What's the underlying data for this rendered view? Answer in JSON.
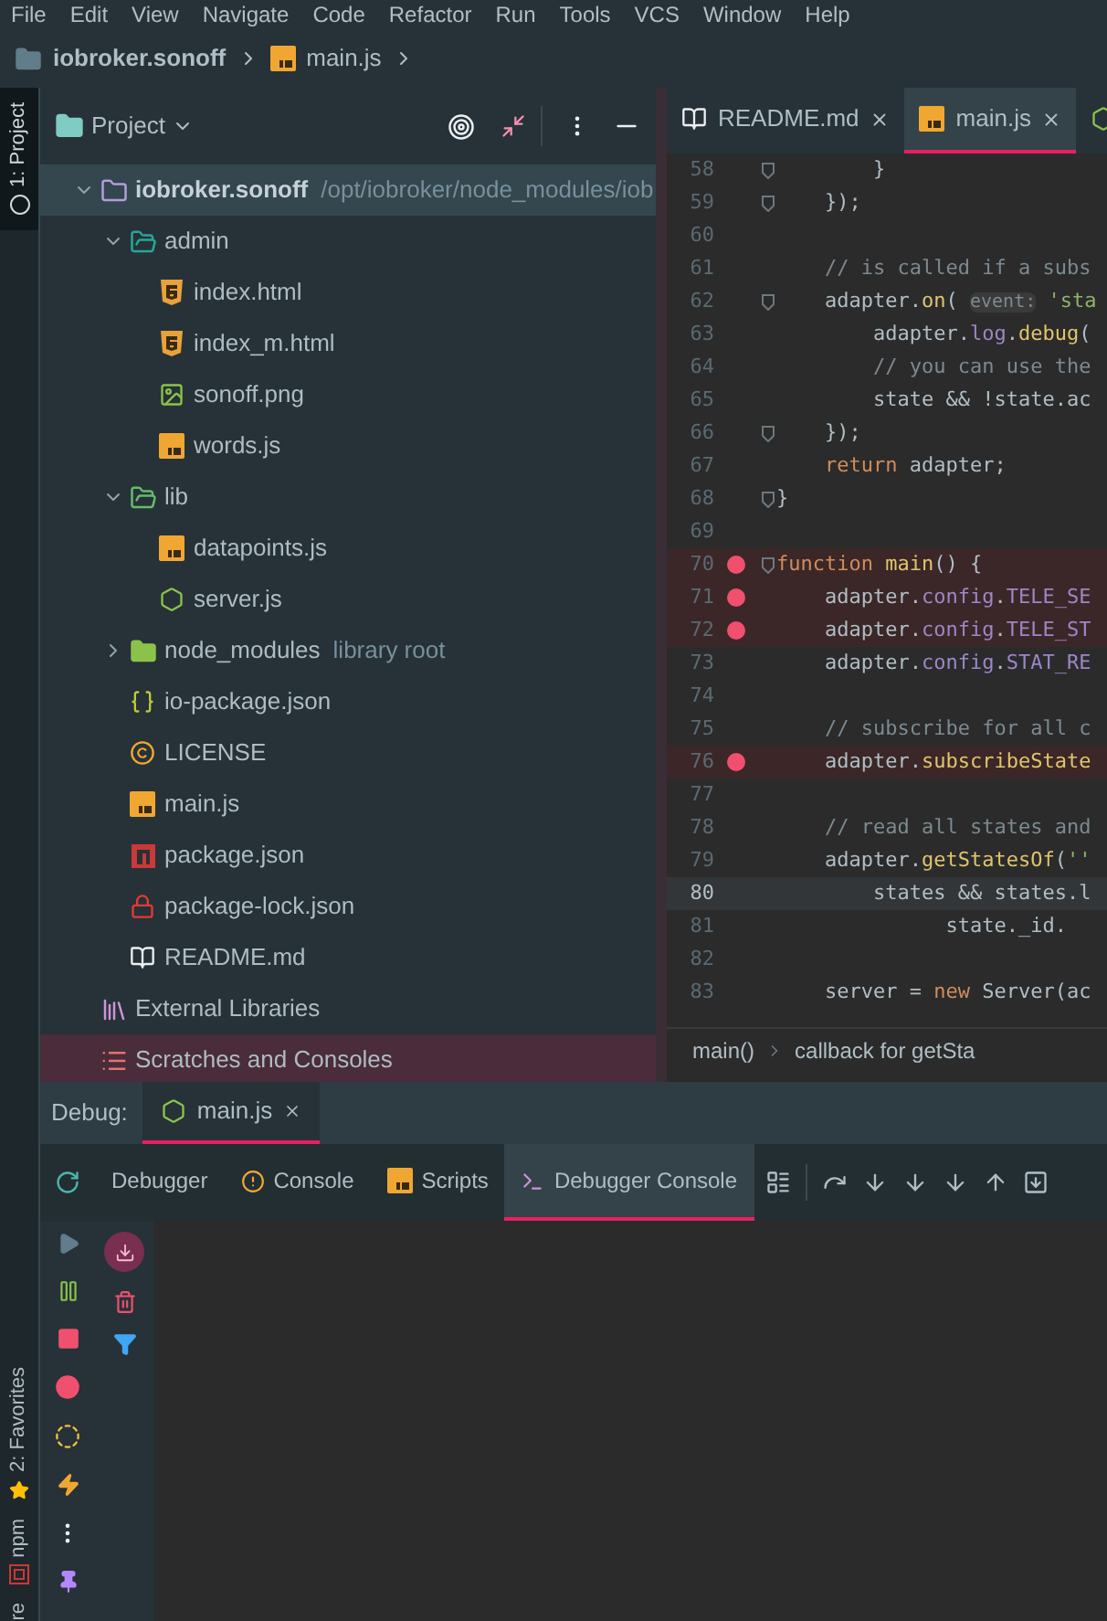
{
  "menu": [
    "File",
    "Edit",
    "View",
    "Navigate",
    "Code",
    "Refactor",
    "Run",
    "Tools",
    "VCS",
    "Window",
    "Help"
  ],
  "breadcrumb": [
    {
      "kind": "folder",
      "label": "iobroker.sonoff"
    },
    {
      "kind": "js",
      "label": "main.js"
    }
  ],
  "tool_strip": {
    "top": [
      {
        "label": "1: Project",
        "selected": true
      }
    ],
    "bottom": [
      {
        "kind": "structure",
        "label": "re"
      },
      {
        "kind": "npm",
        "label": "npm"
      },
      {
        "kind": "favorites",
        "label": "2: Favorites"
      }
    ]
  },
  "project": {
    "title": "Project",
    "tree": [
      {
        "kind": "module",
        "label": "iobroker.sonoff",
        "path": "/opt/iobroker/node_modules/iob",
        "selected": true,
        "marked": false,
        "expanded": true,
        "children": [
          {
            "kind": "admin",
            "label": "admin",
            "selected": false,
            "marked": false,
            "expanded": true,
            "children": [
              {
                "kind": "html",
                "label": "index.html",
                "selected": false,
                "marked": false
              },
              {
                "kind": "html",
                "label": "index_m.html",
                "selected": false,
                "marked": false
              },
              {
                "kind": "image",
                "label": "sonoff.png",
                "selected": false,
                "marked": false
              },
              {
                "kind": "js",
                "label": "words.js",
                "selected": false,
                "marked": false
              }
            ]
          },
          {
            "kind": "lib",
            "label": "lib",
            "selected": false,
            "marked": false,
            "expanded": true,
            "children": [
              {
                "kind": "js",
                "label": "datapoints.js",
                "selected": false,
                "marked": false
              },
              {
                "kind": "nodejs",
                "label": "server.js",
                "selected": false,
                "marked": false
              }
            ]
          },
          {
            "kind": "nodemodules",
            "label": "node_modules",
            "tag": "library root",
            "selected": false,
            "marked": false,
            "expanded": false
          },
          {
            "kind": "json",
            "label": "io-package.json",
            "selected": false,
            "marked": false
          },
          {
            "kind": "license",
            "label": "LICENSE",
            "selected": false,
            "marked": false
          },
          {
            "kind": "js",
            "label": "main.js",
            "selected": false,
            "marked": false
          },
          {
            "kind": "npm",
            "label": "package.json",
            "selected": false,
            "marked": false
          },
          {
            "kind": "lock",
            "label": "package-lock.json",
            "selected": false,
            "marked": false
          },
          {
            "kind": "readme",
            "label": "README.md",
            "selected": false,
            "marked": false
          }
        ]
      },
      {
        "kind": "libraries",
        "label": "External Libraries",
        "selected": false,
        "marked": false
      },
      {
        "kind": "scratches",
        "label": "Scratches and Consoles",
        "selected": false,
        "marked": true
      }
    ]
  },
  "editor": {
    "tabs": [
      {
        "kind": "readme",
        "label": "README.md",
        "selected": false
      },
      {
        "kind": "js",
        "label": "main.js",
        "selected": true
      },
      {
        "kind": "nodejs",
        "selected": false
      }
    ],
    "lines": [
      {
        "number": "58",
        "fold": true,
        "breakpoint": false,
        "current": false,
        "tokens": [
          {
            "kind": "plain",
            "text": "        }"
          }
        ]
      },
      {
        "number": "59",
        "fold": true,
        "breakpoint": false,
        "current": false,
        "tokens": [
          {
            "kind": "plain",
            "text": "    });"
          }
        ]
      },
      {
        "number": "60",
        "breakpoint": false,
        "current": false
      },
      {
        "number": "61",
        "breakpoint": false,
        "current": false,
        "tokens": [
          {
            "kind": "comment",
            "text": "    // is called if a subs"
          }
        ]
      },
      {
        "number": "62",
        "fold": true,
        "breakpoint": false,
        "current": false,
        "tokens": [
          {
            "kind": "plain",
            "text": "    adapter."
          },
          {
            "kind": "method",
            "text": "on"
          },
          {
            "kind": "plain",
            "text": "( "
          },
          {
            "kind": "hint",
            "text": "event:"
          },
          {
            "kind": "string",
            "text": " 'sta"
          }
        ]
      },
      {
        "number": "63",
        "breakpoint": false,
        "current": false,
        "tokens": [
          {
            "kind": "plain",
            "text": "        adapter."
          },
          {
            "kind": "field",
            "text": "log"
          },
          {
            "kind": "plain",
            "text": "."
          },
          {
            "kind": "method",
            "text": "debug"
          },
          {
            "kind": "plain",
            "text": "("
          }
        ]
      },
      {
        "number": "64",
        "breakpoint": false,
        "current": false,
        "tokens": [
          {
            "kind": "comment",
            "text": "        // you can use the"
          }
        ]
      },
      {
        "number": "65",
        "breakpoint": false,
        "current": false,
        "tokens": [
          {
            "kind": "plain",
            "text": "        state && !state.ac"
          }
        ]
      },
      {
        "number": "66",
        "fold": true,
        "breakpoint": false,
        "current": false,
        "tokens": [
          {
            "kind": "plain",
            "text": "    });"
          }
        ]
      },
      {
        "number": "67",
        "breakpoint": false,
        "current": false,
        "tokens": [
          {
            "kind": "keyword",
            "text": "    return"
          },
          {
            "kind": "plain",
            "text": " adapter;"
          }
        ]
      },
      {
        "number": "68",
        "fold": true,
        "breakpoint": false,
        "current": false,
        "tokens": [
          {
            "kind": "plain",
            "text": "}"
          }
        ]
      },
      {
        "number": "69",
        "breakpoint": false,
        "current": false
      },
      {
        "number": "70",
        "fold": true,
        "breakpoint": true,
        "current": false,
        "tokens": [
          {
            "kind": "keyword",
            "text": "function"
          },
          {
            "kind": "method",
            "text": " main"
          },
          {
            "kind": "plain",
            "text": "() {"
          }
        ]
      },
      {
        "number": "71",
        "breakpoint": true,
        "current": false,
        "tokens": [
          {
            "kind": "plain",
            "text": "    adapter."
          },
          {
            "kind": "field",
            "text": "config"
          },
          {
            "kind": "plain",
            "text": "."
          },
          {
            "kind": "field",
            "text": "TELE_SE"
          }
        ]
      },
      {
        "number": "72",
        "breakpoint": true,
        "current": false,
        "tokens": [
          {
            "kind": "plain",
            "text": "    adapter."
          },
          {
            "kind": "field",
            "text": "config"
          },
          {
            "kind": "plain",
            "text": "."
          },
          {
            "kind": "field",
            "text": "TELE_ST"
          }
        ]
      },
      {
        "number": "73",
        "breakpoint": false,
        "current": false,
        "tokens": [
          {
            "kind": "plain",
            "text": "    adapter."
          },
          {
            "kind": "field",
            "text": "config"
          },
          {
            "kind": "plain",
            "text": "."
          },
          {
            "kind": "field",
            "text": "STAT_RE"
          }
        ]
      },
      {
        "number": "74",
        "breakpoint": false,
        "current": false
      },
      {
        "number": "75",
        "breakpoint": false,
        "current": false,
        "tokens": [
          {
            "kind": "comment",
            "text": "    // subscribe for all c"
          }
        ]
      },
      {
        "number": "76",
        "breakpoint": true,
        "current": false,
        "tokens": [
          {
            "kind": "plain",
            "text": "    adapter."
          },
          {
            "kind": "method",
            "text": "subscribeState"
          }
        ]
      },
      {
        "number": "77",
        "breakpoint": false,
        "current": false
      },
      {
        "number": "78",
        "breakpoint": false,
        "current": false,
        "tokens": [
          {
            "kind": "comment",
            "text": "    // read all states and"
          }
        ]
      },
      {
        "number": "79",
        "breakpoint": false,
        "current": false,
        "tokens": [
          {
            "kind": "plain",
            "text": "    adapter."
          },
          {
            "kind": "method",
            "text": "getStatesOf"
          },
          {
            "kind": "plain",
            "text": "("
          },
          {
            "kind": "string",
            "text": "''"
          }
        ]
      },
      {
        "number": "80",
        "breakpoint": false,
        "current": true,
        "tokens": [
          {
            "kind": "plain",
            "text": "        states && states.l"
          }
        ]
      },
      {
        "number": "81",
        "breakpoint": false,
        "current": false,
        "tokens": [
          {
            "kind": "plain",
            "text": "              state._id."
          }
        ]
      },
      {
        "number": "82",
        "breakpoint": false,
        "current": false
      },
      {
        "number": "83",
        "breakpoint": false,
        "current": false,
        "tokens": [
          {
            "kind": "plain",
            "text": "    server = "
          },
          {
            "kind": "keyword",
            "text": "new"
          },
          {
            "kind": "plain",
            "text": " Server(ac"
          }
        ]
      }
    ],
    "path": [
      "main()",
      "callback for getSta"
    ]
  },
  "debug": {
    "label": "Debug:",
    "tabs": [
      {
        "label": "main.js",
        "selected": true
      }
    ],
    "views": [
      {
        "kind": "debugger",
        "label": "Debugger",
        "selected": false
      },
      {
        "kind": "console",
        "label": "Console",
        "selected": false
      },
      {
        "kind": "scripts",
        "label": "Scripts",
        "selected": false
      },
      {
        "kind": "terminal",
        "label": "Debugger Console",
        "selected": true
      }
    ]
  }
}
